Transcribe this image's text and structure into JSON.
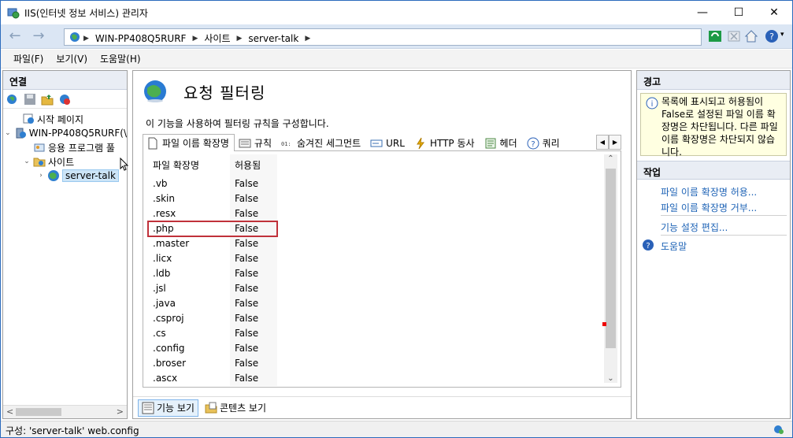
{
  "window": {
    "title": "IIS(인터넷 정보 서비스) 관리자",
    "minimize": "—",
    "maximize": "☐",
    "close": "✕"
  },
  "address": {
    "back": "←",
    "forward": "→",
    "crumbs": [
      "WIN-PP408Q5RURF",
      "사이트",
      "server-talk"
    ],
    "sep": "▶"
  },
  "menu": [
    "파일(F)",
    "보기(V)",
    "도움말(H)"
  ],
  "connections": {
    "header": "연결",
    "tree": [
      {
        "label": "시작 페이지",
        "icon": "start-page-icon",
        "exp": ""
      },
      {
        "label": "WIN-PP408Q5RURF(\\",
        "icon": "server-icon",
        "exp": "⌄"
      },
      {
        "label": "응용 프로그램 풀",
        "icon": "app-pool-icon",
        "exp": ""
      },
      {
        "label": "사이트",
        "icon": "sites-folder-icon",
        "exp": "⌄"
      },
      {
        "label": "server-talk",
        "icon": "globe-icon",
        "exp": "›"
      }
    ],
    "scroll_left": "<",
    "scroll_right": ">"
  },
  "feature": {
    "title": "요청 필터링",
    "description": "이 기능을 사용하여 필터링 규칙을 구성합니다.",
    "tabs": [
      {
        "label": "파일 이름 확장명",
        "icon": "file-icon"
      },
      {
        "label": "규칙",
        "icon": "rules-icon"
      },
      {
        "label": "숨겨진 세그먼트",
        "icon": "segment-icon"
      },
      {
        "label": "URL",
        "icon": "url-icon"
      },
      {
        "label": "HTTP 동사",
        "icon": "verb-icon"
      },
      {
        "label": "헤더",
        "icon": "header-icon"
      },
      {
        "label": "쿼리 ",
        "icon": "help-icon"
      }
    ],
    "tab_prev": "◀",
    "tab_next": "▶",
    "columns": [
      "파일 확장명",
      "허용됨"
    ],
    "rows": [
      [
        ".vb",
        "False"
      ],
      [
        ".skin",
        "False"
      ],
      [
        ".resx",
        "False"
      ],
      [
        ".php",
        "False"
      ],
      [
        ".master",
        "False"
      ],
      [
        ".licx",
        "False"
      ],
      [
        ".ldb",
        "False"
      ],
      [
        ".jsl",
        "False"
      ],
      [
        ".java",
        "False"
      ],
      [
        ".csproj",
        "False"
      ],
      [
        ".cs",
        "False"
      ],
      [
        ".config",
        "False"
      ],
      [
        ".broser",
        "False"
      ],
      [
        ".ascx",
        "False"
      ]
    ],
    "highlighted_row": ".php",
    "scroll_up": "⌃",
    "scroll_down": "⌄",
    "view_feature": "기능 보기",
    "view_content": "콘텐츠 보기"
  },
  "actions": {
    "alert_header": "경고",
    "alert_text": "목록에 표시되고 허용됨이 False로 설정된 파일 이름 확장명은 차단됩니다. 다른 파일 이름 확장명은 차단되지 않습니다.",
    "tasks_header": "작업",
    "items": [
      "파일 이름 확장명 허용...",
      "파일 이름 확장명 거부...",
      "기능 설정 편집...",
      "도움말"
    ]
  },
  "status": {
    "text": "구성: 'server-talk' web.config"
  },
  "colors": {
    "accent": "#1e63b6",
    "highlight_border": "#c0313a",
    "alert_bg": "#ffffe1"
  }
}
